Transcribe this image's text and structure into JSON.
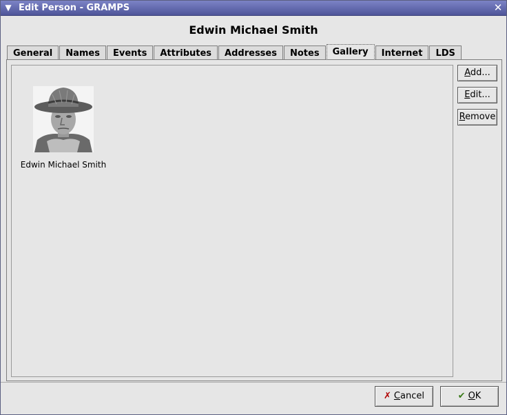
{
  "window": {
    "title": "Edit Person - GRAMPS"
  },
  "person_name": "Edwin Michael Smith",
  "tabs": [
    {
      "label": "General"
    },
    {
      "label": "Names"
    },
    {
      "label": "Events"
    },
    {
      "label": "Attributes"
    },
    {
      "label": "Addresses"
    },
    {
      "label": "Notes"
    },
    {
      "label": "Gallery",
      "active": true
    },
    {
      "label": "Internet"
    },
    {
      "label": "LDS"
    }
  ],
  "gallery": {
    "items": [
      {
        "caption": "Edwin Michael Smith",
        "icon": "portrait-photo"
      }
    ]
  },
  "side_buttons": {
    "add": {
      "mnemonic": "A",
      "rest": "dd..."
    },
    "edit": {
      "mnemonic": "E",
      "rest": "dit..."
    },
    "remove": {
      "mnemonic": "R",
      "rest": "emove"
    }
  },
  "dialog_buttons": {
    "cancel": {
      "mnemonic": "C",
      "rest": "ancel",
      "icon": "cancel-x-icon"
    },
    "ok": {
      "mnemonic": "O",
      "rest": "K",
      "icon": "ok-check-icon"
    }
  },
  "colors": {
    "titlebar": "#5b62a8",
    "background": "#e6e6e6"
  }
}
